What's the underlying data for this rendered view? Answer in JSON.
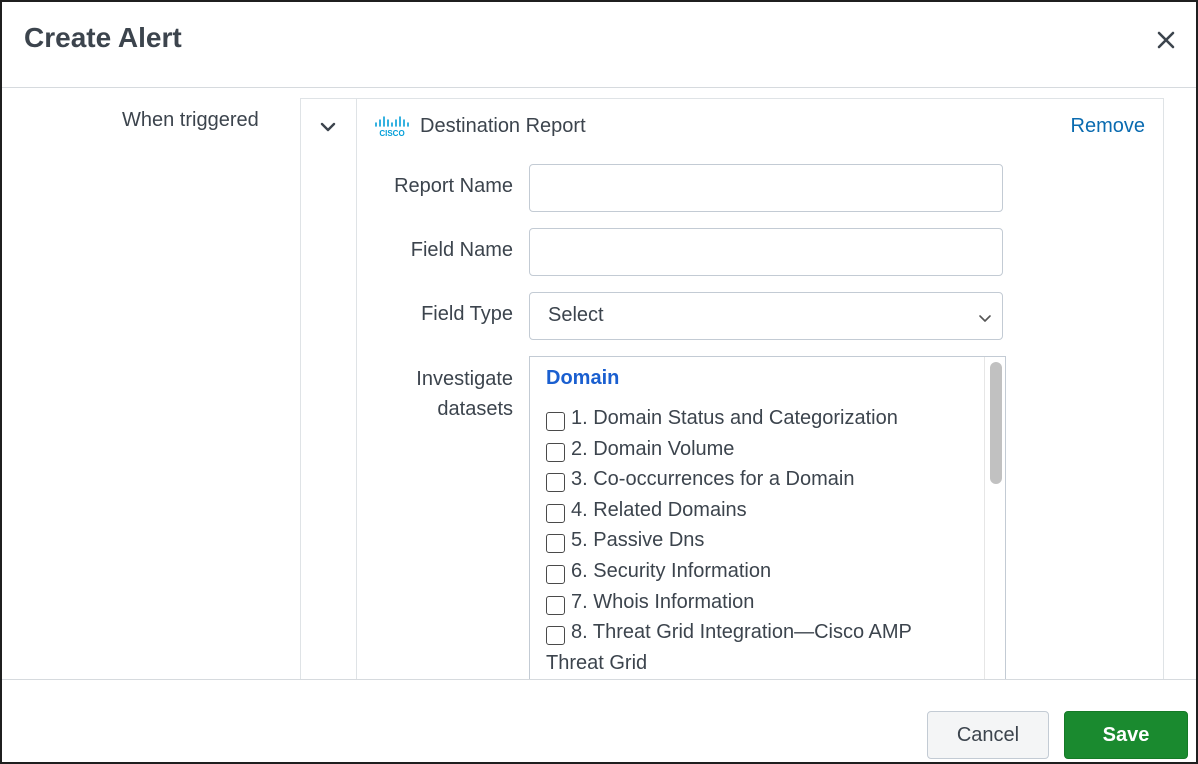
{
  "dialog": {
    "title": "Create Alert",
    "close_icon": "close-icon"
  },
  "trigger": {
    "label": "When triggered",
    "expand_icon": "chevron-down-icon"
  },
  "action": {
    "logo_icon": "cisco-logo-icon",
    "title": "Destination Report",
    "remove_label": "Remove",
    "brand_color": "#049fd9",
    "link_color": "#0a6bb0"
  },
  "form": {
    "report_name": {
      "label": "Report Name",
      "value": "",
      "placeholder": ""
    },
    "field_name": {
      "label": "Field Name",
      "value": "",
      "placeholder": ""
    },
    "field_type": {
      "label": "Field Type",
      "selected": "Select"
    },
    "datasets": {
      "label_line1": "Investigate",
      "label_line2": "datasets",
      "group_title": "Domain",
      "group_color": "#1a5fd0",
      "items": [
        {
          "label": "1. Domain Status and Categorization",
          "checked": false
        },
        {
          "label": "2. Domain Volume",
          "checked": false
        },
        {
          "label": "3. Co-occurrences for a Domain",
          "checked": false
        },
        {
          "label": "4. Related Domains",
          "checked": false
        },
        {
          "label": "5. Passive Dns",
          "checked": false
        },
        {
          "label": "6. Security Information",
          "checked": false
        },
        {
          "label": "7. Whois Information",
          "checked": false
        },
        {
          "label": "8. Threat Grid Integration—Cisco AMP Threat Grid",
          "checked": false
        }
      ]
    }
  },
  "footer": {
    "cancel_label": "Cancel",
    "save_label": "Save",
    "save_color": "#1a8a2f"
  }
}
